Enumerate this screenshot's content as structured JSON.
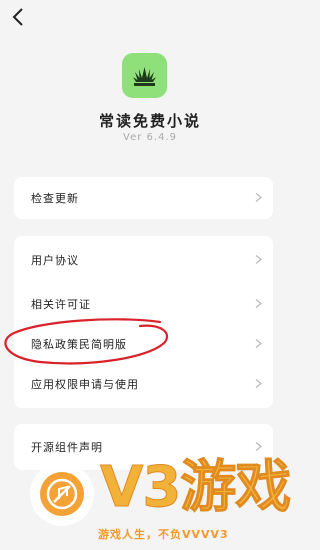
{
  "header": {
    "back_icon": "chevron-left-icon"
  },
  "app": {
    "name": "常读免费小说",
    "version": "Ver 6.4.9",
    "logo_color": "#8fe07a"
  },
  "menu": {
    "update_card": [
      {
        "label": "检查更新"
      }
    ],
    "legal_card": [
      {
        "label": "用户协议"
      },
      {
        "label": "相关许可证"
      },
      {
        "label": "隐私政策民简明版"
      },
      {
        "label": "应用权限申请与使用"
      }
    ],
    "opensource_card": [
      {
        "label": "开源组件声明"
      }
    ]
  },
  "watermark": {
    "brand": "V3游戏",
    "tagline": "游戏人生，不负VVVV3",
    "color": "#f2b23a"
  },
  "annotation": {
    "color": "#d9222a"
  }
}
